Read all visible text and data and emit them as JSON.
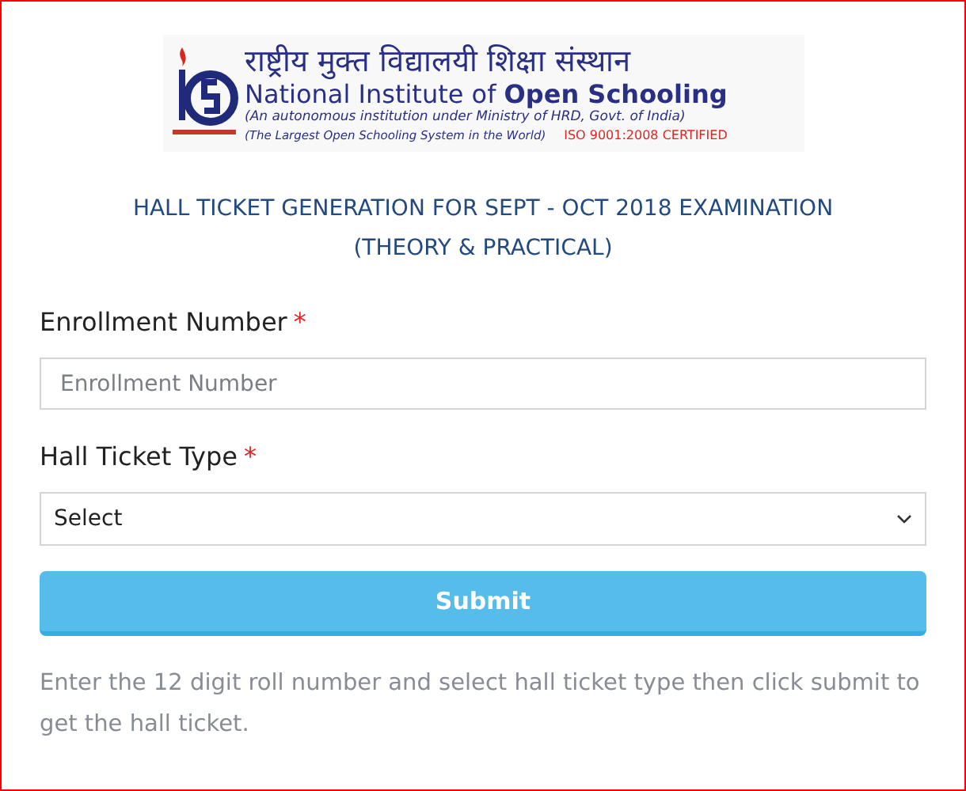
{
  "logo": {
    "hindi_name": "राष्ट्रीय मुक्त विद्यालयी शिक्षा संस्थान",
    "name_prefix": "National Institute of ",
    "name_bold": "Open Schooling",
    "subtitle": "(An autonomous institution under  Ministry of HRD, Govt. of India)",
    "tagline": "(The Largest Open Schooling System in the World)",
    "certification": "ISO 9001:2008 CERTIFIED"
  },
  "heading": [
    "HALL TICKET GENERATION FOR SEPT - OCT 2018 EXAMINATION",
    "(THEORY & PRACTICAL)"
  ],
  "fields": [
    {
      "kind": "text",
      "label": "Enrollment Number",
      "required_mark": "*",
      "placeholder": "Enrollment Number"
    },
    {
      "kind": "select",
      "label": "Hall Ticket Type",
      "required_mark": "*",
      "value": "Select"
    }
  ],
  "submit_button": "Submit",
  "help_text": "Enter the 12 digit roll number and select hall ticket type then click submit to get the hall ticket."
}
